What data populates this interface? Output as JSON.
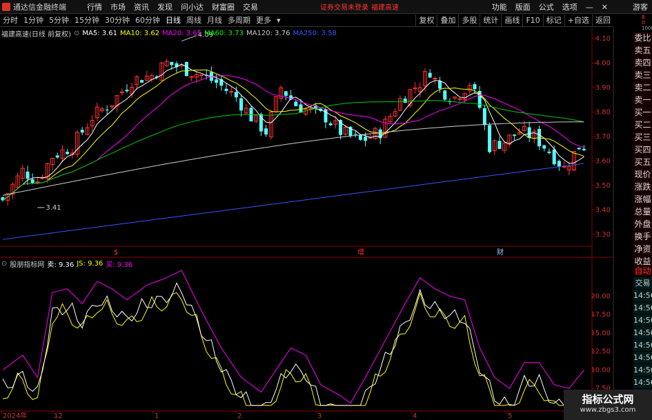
{
  "app": {
    "title": "通达信金融终端",
    "warning": "证券交易未登录",
    "stock": "福建高速"
  },
  "menu": [
    "行情",
    "市场",
    "资讯",
    "发现",
    "问小达",
    "财富圈",
    "交易"
  ],
  "right_menu": [
    "功能",
    "版面",
    "公式",
    "选项"
  ],
  "guest": "游客",
  "periods": [
    "分时",
    "1分钟",
    "5分钟",
    "15分钟",
    "30分钟",
    "60分钟",
    "日线",
    "周线",
    "月线",
    "多周期",
    "更多"
  ],
  "active_period": "日线",
  "toolbar_right": [
    "复权",
    "叠加",
    "多股",
    "统计",
    "画线",
    "F10",
    "标记",
    "+自选",
    "返回"
  ],
  "chart_title": "福建高速(日线 前复权)",
  "ma": [
    {
      "label": "MA5: 3.61",
      "color": "#ffffff"
    },
    {
      "label": "MA10: 3.62",
      "color": "#ffff00"
    },
    {
      "label": "MA20: 3.65",
      "color": "#ff00ff"
    },
    {
      "label": "MA60: 3.73",
      "color": "#00ff00"
    },
    {
      "label": "MA120: 3.76",
      "color": "#cccccc"
    },
    {
      "label": "MA250: 3.58",
      "color": "#3355ff"
    }
  ],
  "price_axis": [
    "4.10",
    "4.00",
    "3.90",
    "3.80",
    "3.70",
    "3.60",
    "3.50",
    "3.40",
    "3.30"
  ],
  "max_label": "4.09",
  "min_label": "3.41",
  "markers": [
    "$",
    "增",
    "财"
  ],
  "indicator": {
    "name": "股朋指标网",
    "sell": "卖: 9.36",
    "js": "JS: 9.36",
    "buy": "买: 9.36"
  },
  "ind_axis": [
    "20.00",
    "17.50",
    "15.00",
    "12.50",
    "10.00",
    "7.50"
  ],
  "dates": [
    "2024年",
    "12",
    "1",
    "2",
    "3",
    "4",
    "5"
  ],
  "side_panel": [
    "委比",
    "卖五",
    "卖四",
    "卖三",
    "卖二",
    "卖一",
    "买一",
    "买二",
    "买三",
    "买四",
    "买五",
    "现价",
    "涨跌",
    "涨幅",
    "总量",
    "外盘",
    "换手",
    "净资",
    "收益"
  ],
  "side_panel2": [
    "自动",
    "交易",
    "14:56",
    "14:56",
    "14:56",
    "14:56",
    "14:56",
    "14:56",
    "14:56",
    "14:56",
    "14:56",
    "14:56"
  ],
  "watermark": {
    "t1": "指标公式网",
    "t2": "www.zbgs3.com"
  },
  "corner": [
    "B",
    "D",
    "1000"
  ]
}
